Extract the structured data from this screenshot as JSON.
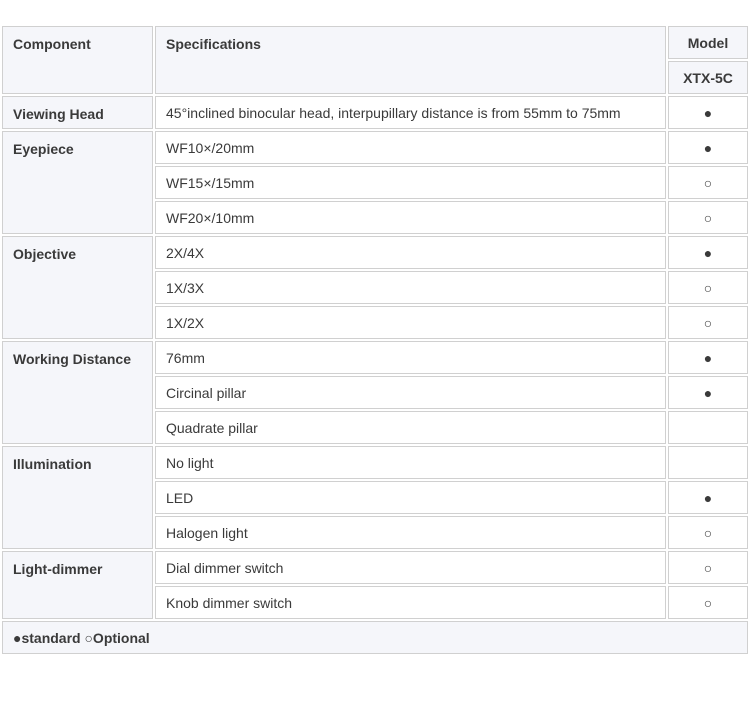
{
  "header": {
    "component": "Component",
    "specifications": "Specifications",
    "model": "Model",
    "model_name": "XTX-5C"
  },
  "groups": [
    {
      "name": "Viewing Head",
      "rows": [
        {
          "spec": "45°inclined binocular head, interpupillary distance is from 55mm to 75mm",
          "mark": "●"
        }
      ]
    },
    {
      "name": "Eyepiece",
      "rows": [
        {
          "spec": "WF10×/20mm",
          "mark": "●"
        },
        {
          "spec": "WF15×/15mm",
          "mark": "○"
        },
        {
          "spec": "WF20×/10mm",
          "mark": "○"
        }
      ]
    },
    {
      "name": "Objective",
      "rows": [
        {
          "spec": "2X/4X",
          "mark": "●"
        },
        {
          "spec": "1X/3X",
          "mark": "○"
        },
        {
          "spec": "1X/2X",
          "mark": "○"
        }
      ]
    },
    {
      "name": "Working Distance",
      "rows": [
        {
          "spec": "76mm",
          "mark": "●"
        },
        {
          "spec": "Circinal pillar",
          "mark": "●"
        },
        {
          "spec": "Quadrate pillar",
          "mark": ""
        }
      ]
    },
    {
      "name": "Illumination",
      "rows": [
        {
          "spec": "No light",
          "mark": ""
        },
        {
          "spec": "LED",
          "mark": "●"
        },
        {
          "spec": "Halogen light",
          "mark": "○"
        }
      ]
    },
    {
      "name": "Light-dimmer",
      "rows": [
        {
          "spec": "Dial dimmer switch",
          "mark": "○"
        },
        {
          "spec": "Knob dimmer switch",
          "mark": "○"
        }
      ]
    }
  ],
  "legend": "●standard ○Optional"
}
